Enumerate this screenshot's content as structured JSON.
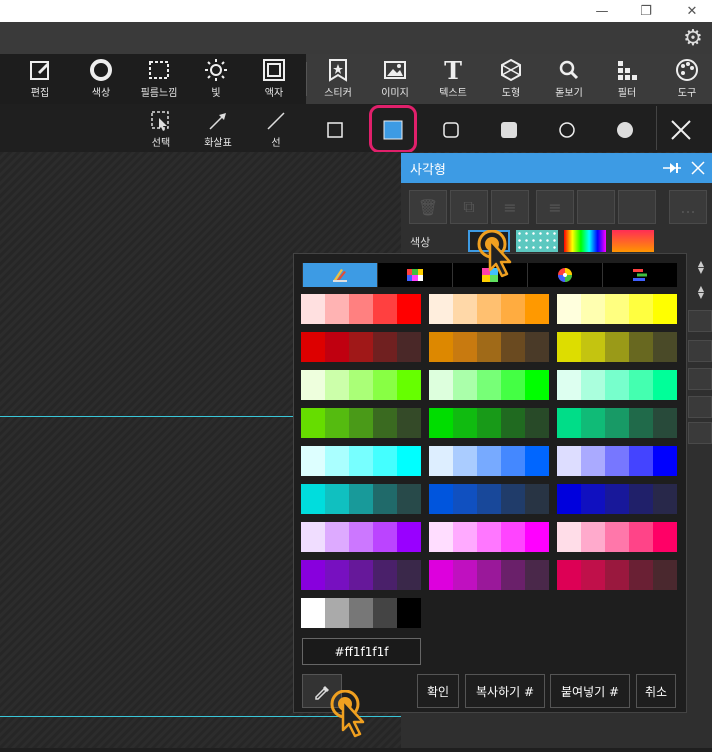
{
  "window": {
    "controls": [
      "minimize",
      "restore",
      "close"
    ]
  },
  "header": {
    "settings_icon": "gear-icon"
  },
  "toolbar": {
    "items": [
      {
        "label": "편집",
        "icon": "edit-icon"
      },
      {
        "label": "색상",
        "icon": "circle-icon"
      },
      {
        "label": "필름느낌",
        "icon": "film-icon"
      },
      {
        "label": "빛",
        "icon": "sun-icon"
      },
      {
        "label": "액자",
        "icon": "frame-icon"
      },
      {
        "label": "스티커",
        "icon": "sticker-icon"
      },
      {
        "label": "이미지",
        "icon": "image-icon"
      },
      {
        "label": "텍스트",
        "icon": "text-icon"
      },
      {
        "label": "도형",
        "icon": "shape-icon"
      },
      {
        "label": "돋보기",
        "icon": "magnifier-icon"
      },
      {
        "label": "필터",
        "icon": "filter-icon"
      },
      {
        "label": "도구",
        "icon": "palette-icon"
      }
    ]
  },
  "subtoolbar": {
    "items": [
      {
        "label": "선택",
        "icon": "select-icon"
      },
      {
        "label": "화살표",
        "icon": "arrow-icon"
      },
      {
        "label": "선",
        "icon": "line-icon"
      }
    ],
    "shapes": [
      "square-outline",
      "square-filled",
      "rounded-square-outline",
      "rounded-square-filled",
      "circle-outline",
      "circle-filled"
    ],
    "selected_shape_color": "#3d9be4",
    "highlight_color": "#e0206b"
  },
  "panel": {
    "title": "사각형",
    "more_label": "...",
    "color_label": "색상"
  },
  "color_picker": {
    "tabs": [
      "swatches",
      "grid",
      "mixer",
      "wheel",
      "bars"
    ],
    "palettes": [
      [
        "#ffe0e0",
        "#ffb3b3",
        "#ff8080",
        "#ff4040",
        "#ff0000"
      ],
      [
        "#ffeedd",
        "#ffd8a8",
        "#ffc070",
        "#ffac40",
        "#ff9900"
      ],
      [
        "#ffffdd",
        "#ffffb0",
        "#ffff80",
        "#ffff40",
        "#ffff00"
      ],
      [
        "#dd0000",
        "#c00010",
        "#a01818",
        "#702020",
        "#4a2828"
      ],
      [
        "#dd8800",
        "#c87a10",
        "#a06a18",
        "#6a4a20",
        "#4a3a28"
      ],
      [
        "#dddd00",
        "#c4c410",
        "#9a9a18",
        "#686820",
        "#4a4a28"
      ],
      [
        "#eeffdd",
        "#ccffaa",
        "#aaff77",
        "#88ff44",
        "#66ff00"
      ],
      [
        "#ddffdd",
        "#aaffaa",
        "#77ff77",
        "#44ff44",
        "#00ff00"
      ],
      [
        "#ddfff0",
        "#aaffdd",
        "#77ffcc",
        "#44ffb0",
        "#00ff99"
      ],
      [
        "#66dd00",
        "#55bb10",
        "#4a9a18",
        "#3a6a20",
        "#344a28"
      ],
      [
        "#00dd00",
        "#10bb10",
        "#189a18",
        "#206a20",
        "#284a28"
      ],
      [
        "#00dd88",
        "#10bb77",
        "#189a66",
        "#206a4a",
        "#284a3a"
      ],
      [
        "#ddffff",
        "#aaffff",
        "#77ffff",
        "#44ffff",
        "#00ffff"
      ],
      [
        "#ddeeff",
        "#aaccff",
        "#77aaff",
        "#4488ff",
        "#0066ff"
      ],
      [
        "#ddddff",
        "#aaaaff",
        "#7777ff",
        "#4444ff",
        "#0000ff"
      ],
      [
        "#00dddd",
        "#10c0c0",
        "#189a9a",
        "#206a6a",
        "#284a4a"
      ],
      [
        "#0055dd",
        "#1050c0",
        "#18489a",
        "#203c6a",
        "#283444"
      ],
      [
        "#0000dd",
        "#1010c0",
        "#18189a",
        "#20206a",
        "#28284a"
      ],
      [
        "#f0ddff",
        "#ddaaff",
        "#cc77ff",
        "#bb44ff",
        "#9900ff"
      ],
      [
        "#ffddff",
        "#ffaaff",
        "#ff77ff",
        "#ff44ff",
        "#ff00ff"
      ],
      [
        "#ffdde8",
        "#ffaacc",
        "#ff77aa",
        "#ff4488",
        "#ff0066"
      ],
      [
        "#8800dd",
        "#7710c0",
        "#66189a",
        "#4a206a",
        "#3a284a"
      ],
      [
        "#dd00dd",
        "#c010c0",
        "#9a189a",
        "#6a206a",
        "#4a284a"
      ],
      [
        "#dd0055",
        "#c0104a",
        "#9a183e",
        "#6a2034",
        "#4a282e"
      ],
      [
        "#ffffff",
        "#aaaaaa",
        "#777777",
        "#444444",
        "#000000"
      ]
    ],
    "hex_value": "#ff1f1f1f",
    "buttons": {
      "confirm": "확인",
      "copy": "복사하기 #",
      "paste": "붙여넣기 #",
      "cancel": "취소"
    },
    "eyedropper_icon": "eyedropper-icon"
  },
  "canvas": {
    "guide_color": "#39c6d8"
  }
}
